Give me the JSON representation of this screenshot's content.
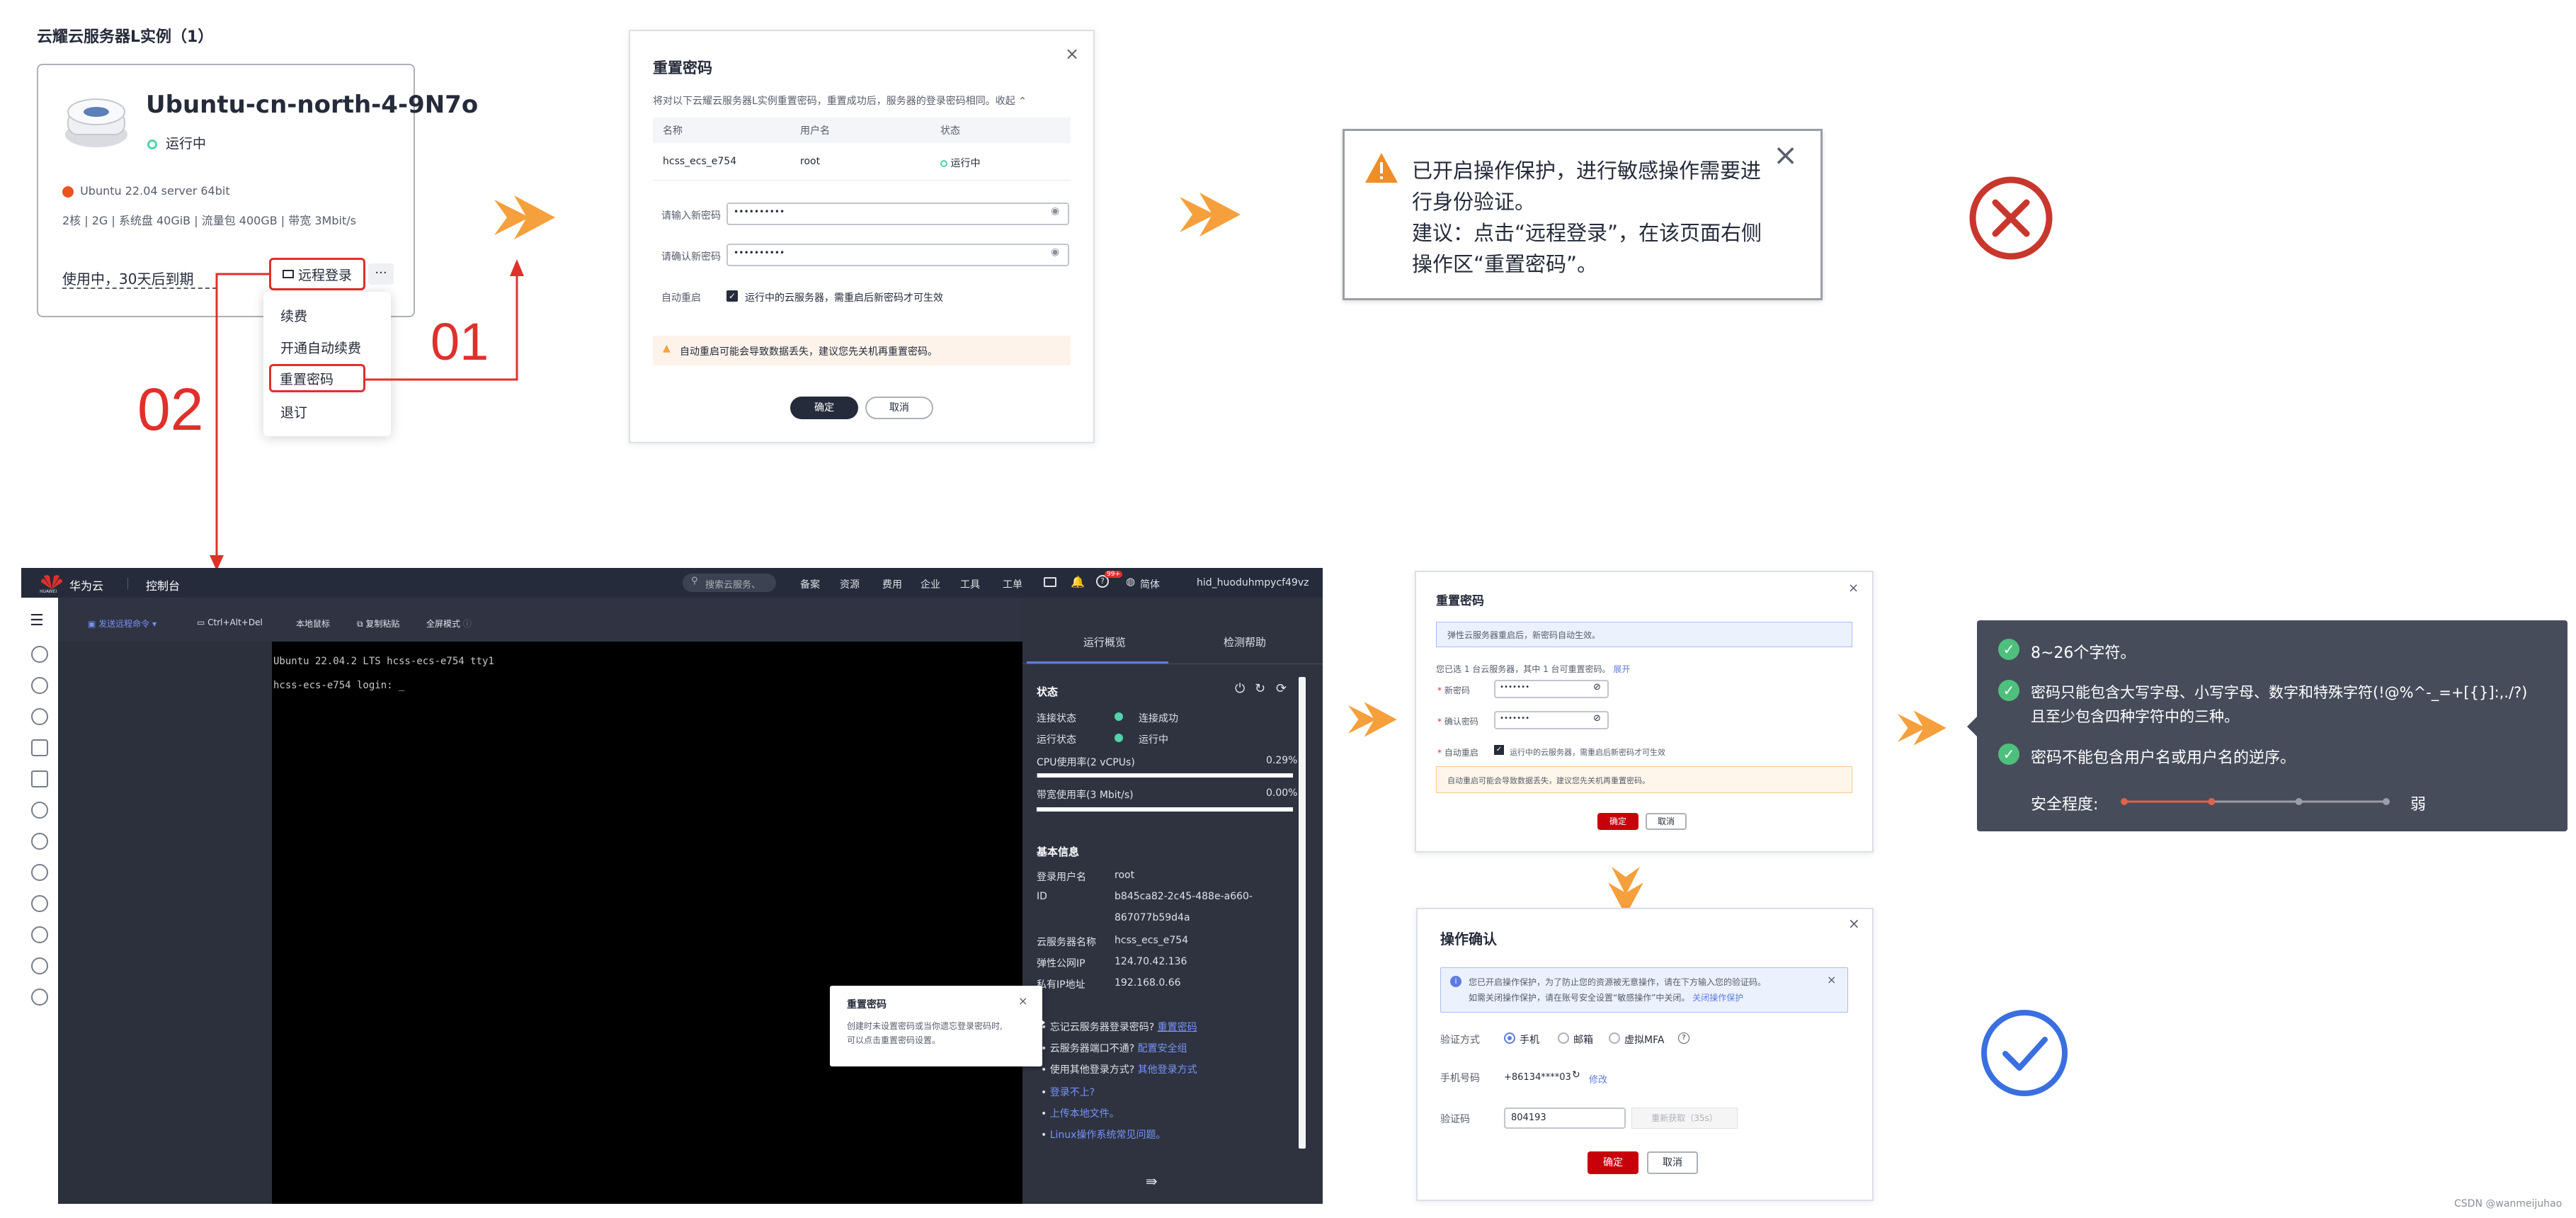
{
  "instance_card": {
    "section_title": "云耀云服务器L实例（1）",
    "name": "Ubuntu-cn-north-4-9N7o",
    "status": "运行中",
    "os": "Ubuntu 22.04 server 64bit",
    "specs": "2核 | 2G | 系统盘 40GiB | 流量包 400GB | 带宽 3Mbit/s",
    "expiry": "使用中，30天后到期",
    "remote_login": "远程登录",
    "more": "···",
    "menu": [
      "续费",
      "开通自动续费",
      "重置密码",
      "退订"
    ]
  },
  "step_labels": {
    "step1": "01",
    "step2": "02"
  },
  "reset_dialog": {
    "title": "重置密码",
    "desc": "将对以下云耀云服务器L实例重置密码，重置成功后，服务器的登录密码相同。收起",
    "columns": [
      "名称",
      "用户名",
      "状态"
    ],
    "row": [
      "hcss_ecs_e754",
      "root",
      "运行中"
    ],
    "new_pwd_label": "请输入新密码",
    "confirm_pwd_label": "请确认新密码",
    "masked": "••••••••••",
    "auto_restart_label": "自动重启",
    "auto_restart_text": "运行中的云服务器，需重启后新密码才可生效",
    "warning": "自动重启可能会导致数据丢失，建议您先关机再重置密码。",
    "ok": "确定",
    "cancel": "取消"
  },
  "protection_notice": {
    "line1": "已开启操作保护，进行敏感操作需要进",
    "line2": "行身份验证。",
    "line3": "建议：点击“远程登录”，在该页面右侧",
    "line4": "操作区“重置密码”。"
  },
  "console": {
    "brand": "华为云",
    "brand_sub": "HUAWEI",
    "console_label": "控制台",
    "search_placeholder": "搜索云服务、",
    "nav": [
      "备案",
      "资源",
      "费用",
      "企业",
      "工具",
      "工单"
    ],
    "lang": "简体",
    "badge": "99+",
    "user": "hid_huoduhmpycf49vz",
    "toolbar": [
      "发送远程命令",
      "Ctrl+Alt+Del",
      "本地鼠标",
      "复制粘贴",
      "全屏模式"
    ],
    "terminal_lines": [
      "Ubuntu 22.04.2 LTS hcss-ecs-e754 tty1",
      "hcss-ecs-e754 login: _"
    ],
    "tabs": [
      "运行概览",
      "检测帮助"
    ],
    "status_title": "状态",
    "conn_label": "连接状态",
    "conn_value": "连接成功",
    "run_label": "运行状态",
    "run_value": "运行中",
    "cpu_label": "CPU使用率(2 vCPUs)",
    "cpu_value": "0.29%",
    "bw_label": "带宽使用率(3 Mbit/s)",
    "bw_value": "0.00%",
    "cpu_fraction": 0.0029,
    "bw_fraction": 0.0,
    "basic_title": "基本信息",
    "info": [
      {
        "k": "登录用户名",
        "v": "root"
      },
      {
        "k": "ID",
        "v": "b845ca82-2c45-488e-a660-"
      },
      {
        "k": "",
        "v": "867077b59d4a"
      },
      {
        "k": "云服务器名称",
        "v": "hcss_ecs_e754"
      },
      {
        "k": "弹性公网IP",
        "v": "124.70.42.136"
      },
      {
        "k": "私有IP地址",
        "v": "192.168.0.66"
      }
    ],
    "links": [
      {
        "pre": "忘记云服务器登录密码?",
        "link": "重置密码"
      },
      {
        "pre": "云服务器端口不通?",
        "link": "配置安全组"
      },
      {
        "pre": "使用其他登录方式?",
        "link": "其他登录方式"
      },
      {
        "pre": "",
        "link": "登录不上?"
      },
      {
        "pre": "",
        "link": "上传本地文件。"
      },
      {
        "pre": "",
        "link": "Linux操作系统常见问题。"
      }
    ],
    "tooltip_title": "重置密码",
    "tooltip_body1": "创建时未设置密码或当你遗忘登录密码时,",
    "tooltip_body2": "可以点击重置密码设置。",
    "collapse": "⇛"
  },
  "dialog2": {
    "title": "重置密码",
    "info": "弹性云服务器重启后，新密码自动生效。",
    "selected": "您已选 1 台云服务器，其中 1 台可重置密码。",
    "expand": "展开",
    "new_pwd": "新密码",
    "confirm_pwd": "确认密码",
    "masked": "•••••••",
    "auto_restart": "自动重启",
    "auto_restart_text": "运行中的云服务器，需重启后新密码才可生效",
    "warning": "自动重启可能会导致数据丢失，建议您先关机再重置密码。",
    "ok": "确定",
    "cancel": "取消"
  },
  "pwd_rules": {
    "rule1": "8~26个字符。",
    "rule2a": "密码只能包含大写字母、小写字母、数字和特殊字符(!@%^-_=+[{}]:,./?)",
    "rule2b": "且至少包含四种字符中的三种。",
    "rule3": "密码不能包含用户名或用户名的逆序。",
    "strength_label": "安全程度:",
    "strength_value": "弱",
    "strength_level": 1,
    "strength_steps": 4
  },
  "confirm_dialog": {
    "title": "操作确认",
    "info1": "您已开启操作保护，为了防止您的资源被无意操作，请在下方输入您的验证码。",
    "info2": "如需关闭操作保护，请在账号安全设置“敏感操作”中关闭。",
    "info_link": "关闭操作保护",
    "method_label": "验证方式",
    "methods": [
      "手机",
      "邮箱",
      "虚拟MFA"
    ],
    "phone_label": "手机号码",
    "phone": "+86134****03",
    "modify": "修改",
    "code_label": "验证码",
    "code": "804193",
    "resend": "重新获取（35s）",
    "ok": "确定",
    "cancel": "取消"
  },
  "watermark": "CSDN @wanmeijuhao",
  "colors": {
    "accent_red": "#e0302b",
    "arrow_orange": "#f5a03c",
    "error": "#c8372d",
    "success": "#3a6fe0",
    "check": "#4ec07d"
  }
}
